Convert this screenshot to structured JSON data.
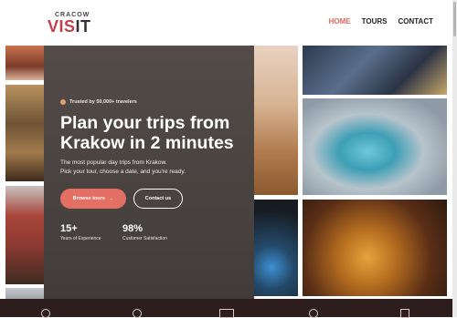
{
  "header": {
    "logo_small": "CRACOW",
    "logo_main_left": "VIS",
    "logo_main_right": "IT",
    "nav": {
      "home": "HOME",
      "tours": "TOURS",
      "contact": "CONTACT"
    },
    "accent_color": "#e0685d"
  },
  "hero": {
    "trusted": "Trusted by 50,000+ travelers",
    "title": "Plan your trips from Krakow in 2 minutes",
    "subtitle_line1": "The most popular day trips from Krakow.",
    "subtitle_line2": "Pick your tour, choose a date, and you're ready.",
    "primary_button": "Browse tours",
    "primary_button_icon": "→",
    "secondary_button": "Contact us",
    "stats": [
      {
        "value": "15+",
        "label": "Years of Experience"
      },
      {
        "value": "98%",
        "label": "Customer Satisfaction"
      }
    ]
  },
  "colors": {
    "primary": "#e36f65",
    "bottom_bar": "#2d1d1d"
  }
}
